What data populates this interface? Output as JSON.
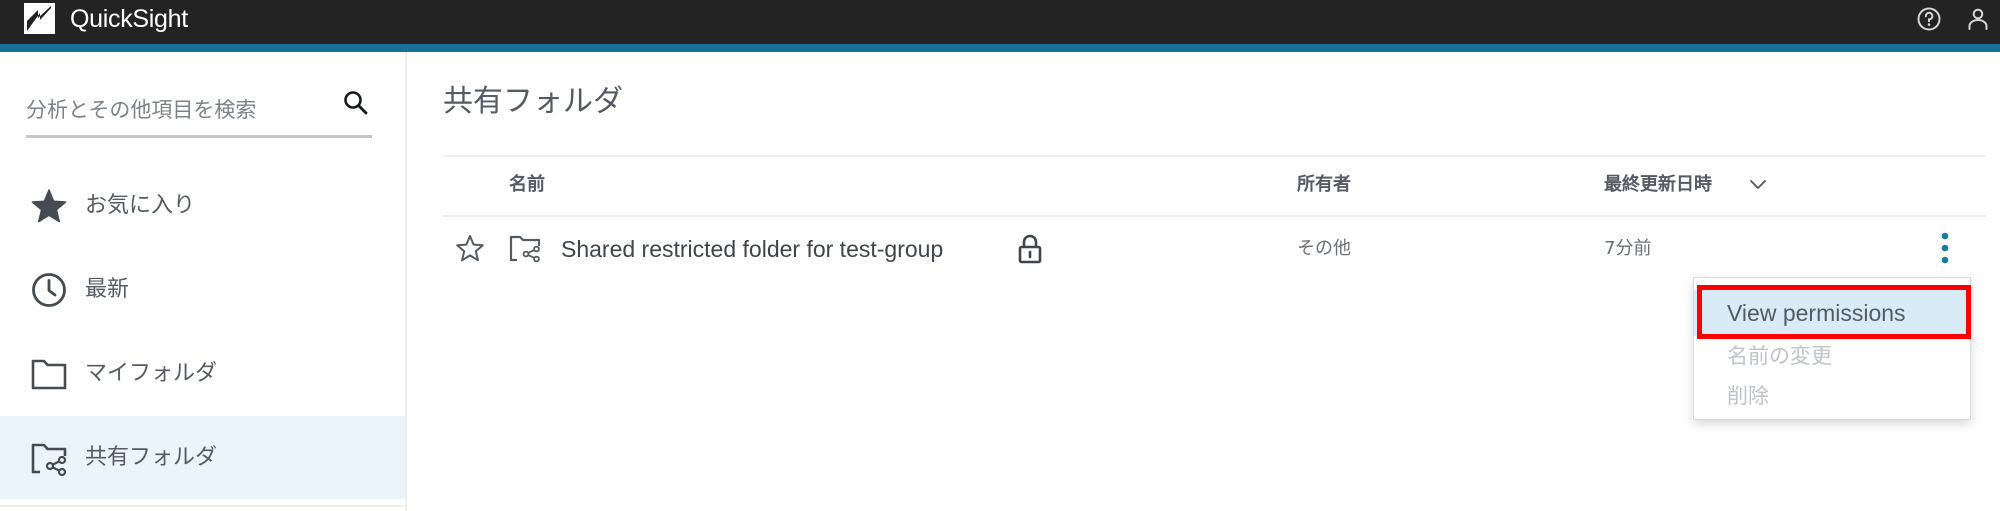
{
  "header": {
    "app_name": "QuickSight",
    "icons": {
      "logo": "quicksight-logo-icon",
      "help": "help-circle-icon",
      "user": "user-icon"
    },
    "colors": {
      "bar": "#232323",
      "accent": "#1a6f98"
    }
  },
  "sidebar": {
    "search": {
      "placeholder": "分析とその他項目を検索",
      "value": "",
      "icon": "search-icon"
    },
    "items": [
      {
        "label": "お気に入り",
        "icon": "star-filled-icon",
        "active": false
      },
      {
        "label": "最新",
        "icon": "clock-icon",
        "active": false
      },
      {
        "label": "マイフォルダ",
        "icon": "folder-icon",
        "active": false
      },
      {
        "label": "共有フォルダ",
        "icon": "shared-folder-icon",
        "active": true
      }
    ],
    "active_color": "#e9f5fb"
  },
  "main": {
    "title": "共有フォルダ",
    "table": {
      "columns": [
        {
          "label": "名前"
        },
        {
          "label": "所有者"
        },
        {
          "label": "最終更新日時",
          "sort": "descending",
          "sort_icon": "chevron-down-icon"
        }
      ],
      "rows": [
        {
          "favorite": false,
          "type_icon": "shared-folder-icon",
          "name": "Shared restricted folder for test-group",
          "restricted_icon": "lock-icon",
          "owner": "その他",
          "last_modified": "7分前",
          "actions_icon": "kebab-menu-icon"
        }
      ]
    }
  },
  "context_menu": {
    "items": [
      {
        "label": "View permissions",
        "state": "highlighted"
      },
      {
        "label": "名前の変更",
        "state": "disabled"
      },
      {
        "label": "削除",
        "state": "disabled"
      }
    ],
    "annotation": {
      "target": "View permissions",
      "color": "#ff0000"
    }
  }
}
